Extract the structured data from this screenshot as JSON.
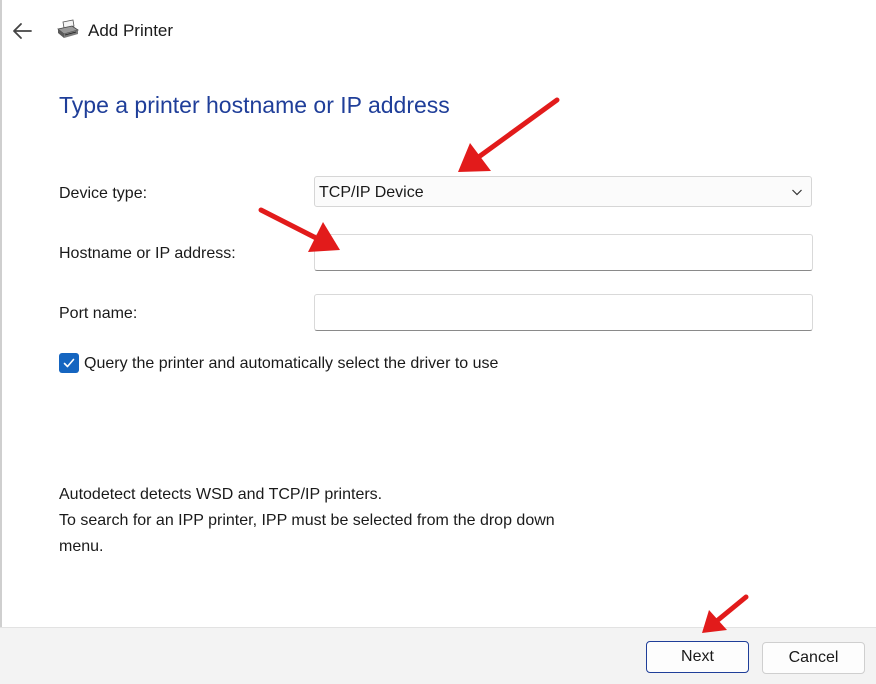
{
  "window": {
    "title": "Add Printer"
  },
  "heading": "Type a printer hostname or IP address",
  "form": {
    "device_type": {
      "label": "Device type:",
      "value": "TCP/IP Device"
    },
    "hostname": {
      "label": "Hostname or IP address:",
      "value": ""
    },
    "port": {
      "label": "Port name:",
      "value": ""
    },
    "query_checkbox": {
      "label": "Query the printer and automatically select the driver to use",
      "checked": true
    }
  },
  "info": {
    "line1": "Autodetect detects WSD and TCP/IP printers.",
    "line2": "To search for an IPP printer, IPP must be selected from the drop down",
    "line3": "menu."
  },
  "footer": {
    "next_label": "Next",
    "cancel_label": "Cancel"
  },
  "colors": {
    "heading": "#1f3e99",
    "accent": "#1565c0",
    "annotation_arrow": "#e21b1b",
    "footer_bg": "#f3f3f3"
  },
  "icons": {
    "back": "back-arrow-icon",
    "printer": "printer-icon",
    "dropdown": "chevron-down-icon",
    "check": "checkmark-icon"
  }
}
